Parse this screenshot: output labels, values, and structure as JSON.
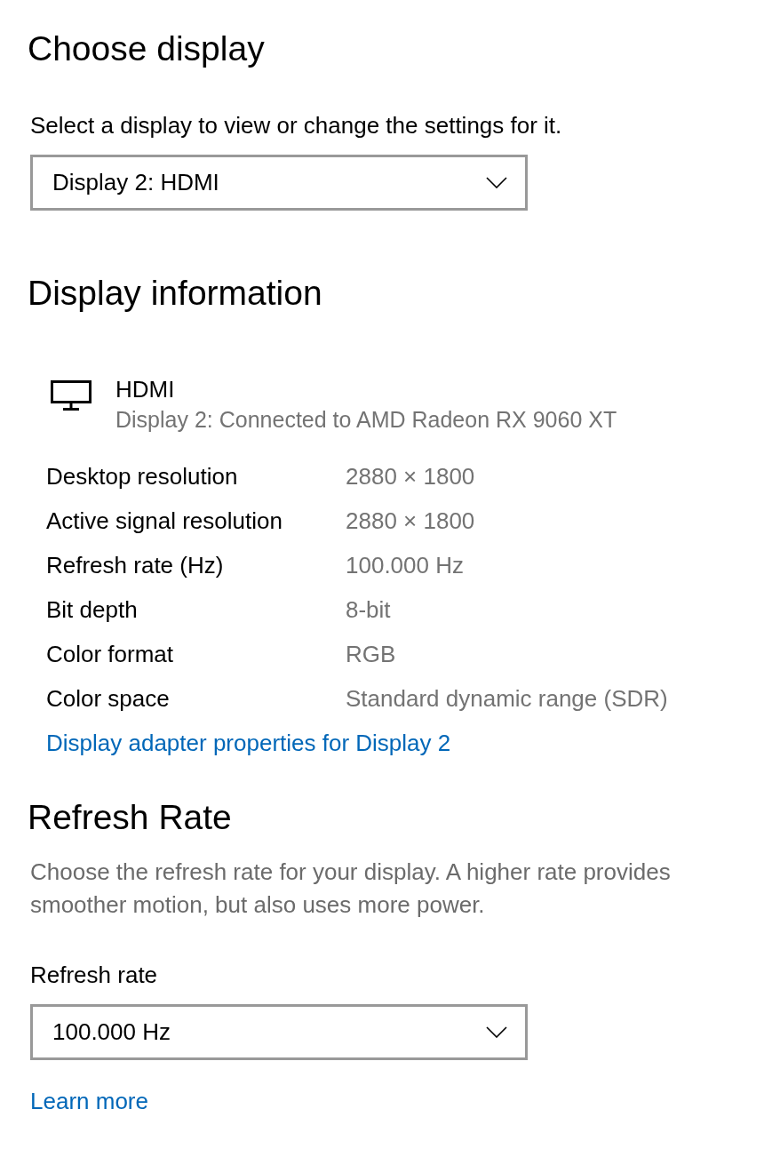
{
  "choose_display": {
    "heading": "Choose display",
    "instruction": "Select a display to view or change the settings for it.",
    "dropdown": {
      "value": "Display 2: HDMI"
    }
  },
  "display_information": {
    "heading": "Display information",
    "monitor": {
      "name": "HDMI",
      "description": "Display 2: Connected to AMD Radeon RX 9060 XT"
    },
    "properties": [
      {
        "label": "Desktop resolution",
        "value": "2880 × 1800"
      },
      {
        "label": "Active signal resolution",
        "value": "2880 × 1800"
      },
      {
        "label": "Refresh rate (Hz)",
        "value": "100.000 Hz"
      },
      {
        "label": "Bit depth",
        "value": "8-bit"
      },
      {
        "label": "Color format",
        "value": "RGB"
      },
      {
        "label": "Color space",
        "value": "Standard dynamic range (SDR)"
      }
    ],
    "link": "Display adapter properties for Display 2"
  },
  "refresh_rate": {
    "heading": "Refresh Rate",
    "description": "Choose the refresh rate for your display. A higher rate provides smoother motion, but also uses more power.",
    "label": "Refresh rate",
    "dropdown": {
      "value": "100.000 Hz"
    },
    "link": "Learn more"
  }
}
